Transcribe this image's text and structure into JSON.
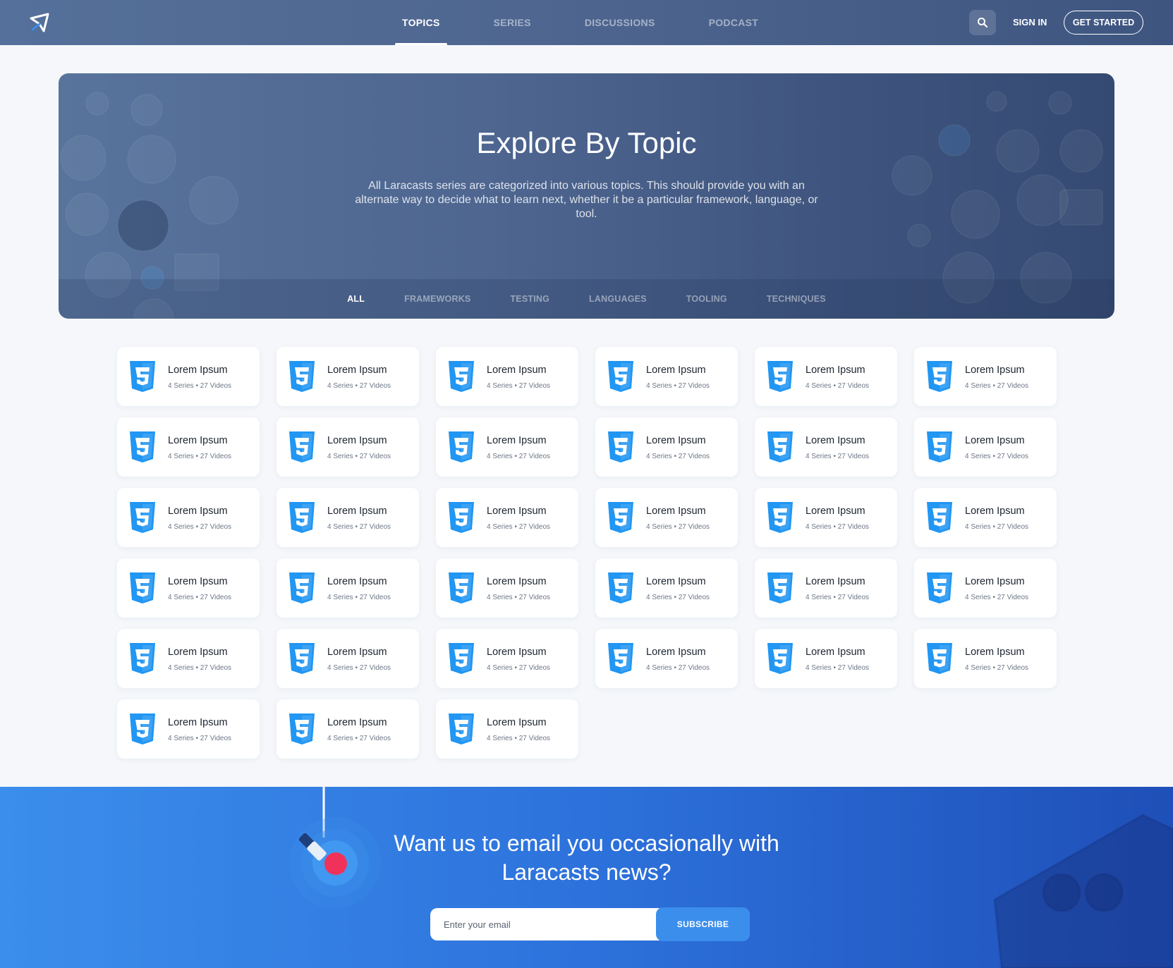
{
  "header": {
    "nav": [
      {
        "label": "TOPICS",
        "active": true
      },
      {
        "label": "SERIES",
        "active": false
      },
      {
        "label": "DISCUSSIONS",
        "active": false
      },
      {
        "label": "PODCAST",
        "active": false
      }
    ],
    "sign_in": "SIGN IN",
    "get_started": "GET STARTED",
    "logo_icon": "paper-plane-logo-icon",
    "search_icon": "search-icon"
  },
  "hero": {
    "title": "Explore By Topic",
    "description": "All Laracasts series are categorized into various topics. This should provide you with an alternate way to decide what to learn next, whether it be a particular framework, language, or tool.",
    "filters": [
      {
        "label": "ALL",
        "active": true
      },
      {
        "label": "FRAMEWORKS",
        "active": false
      },
      {
        "label": "TESTING",
        "active": false
      },
      {
        "label": "LANGUAGES",
        "active": false
      },
      {
        "label": "TOOLING",
        "active": false
      },
      {
        "label": "TECHNIQUES",
        "active": false
      }
    ]
  },
  "topics": {
    "icon": "css3-icon",
    "accent": "#2196f3",
    "items": [
      {
        "title": "Lorem Ipsum",
        "meta": "4 Series • 27 Videos"
      },
      {
        "title": "Lorem Ipsum",
        "meta": "4 Series • 27 Videos"
      },
      {
        "title": "Lorem Ipsum",
        "meta": "4 Series • 27 Videos"
      },
      {
        "title": "Lorem Ipsum",
        "meta": "4 Series • 27 Videos"
      },
      {
        "title": "Lorem Ipsum",
        "meta": "4 Series • 27 Videos"
      },
      {
        "title": "Lorem Ipsum",
        "meta": "4 Series • 27 Videos"
      },
      {
        "title": "Lorem Ipsum",
        "meta": "4 Series • 27 Videos"
      },
      {
        "title": "Lorem Ipsum",
        "meta": "4 Series • 27 Videos"
      },
      {
        "title": "Lorem Ipsum",
        "meta": "4 Series • 27 Videos"
      },
      {
        "title": "Lorem Ipsum",
        "meta": "4 Series • 27 Videos"
      },
      {
        "title": "Lorem Ipsum",
        "meta": "4 Series • 27 Videos"
      },
      {
        "title": "Lorem Ipsum",
        "meta": "4 Series • 27 Videos"
      },
      {
        "title": "Lorem Ipsum",
        "meta": "4 Series • 27 Videos"
      },
      {
        "title": "Lorem Ipsum",
        "meta": "4 Series • 27 Videos"
      },
      {
        "title": "Lorem Ipsum",
        "meta": "4 Series • 27 Videos"
      },
      {
        "title": "Lorem Ipsum",
        "meta": "4 Series • 27 Videos"
      },
      {
        "title": "Lorem Ipsum",
        "meta": "4 Series • 27 Videos"
      },
      {
        "title": "Lorem Ipsum",
        "meta": "4 Series • 27 Videos"
      },
      {
        "title": "Lorem Ipsum",
        "meta": "4 Series • 27 Videos"
      },
      {
        "title": "Lorem Ipsum",
        "meta": "4 Series • 27 Videos"
      },
      {
        "title": "Lorem Ipsum",
        "meta": "4 Series • 27 Videos"
      },
      {
        "title": "Lorem Ipsum",
        "meta": "4 Series • 27 Videos"
      },
      {
        "title": "Lorem Ipsum",
        "meta": "4 Series • 27 Videos"
      },
      {
        "title": "Lorem Ipsum",
        "meta": "4 Series • 27 Videos"
      },
      {
        "title": "Lorem Ipsum",
        "meta": "4 Series • 27 Videos"
      },
      {
        "title": "Lorem Ipsum",
        "meta": "4 Series • 27 Videos"
      },
      {
        "title": "Lorem Ipsum",
        "meta": "4 Series • 27 Videos"
      },
      {
        "title": "Lorem Ipsum",
        "meta": "4 Series • 27 Videos"
      },
      {
        "title": "Lorem Ipsum",
        "meta": "4 Series • 27 Videos"
      },
      {
        "title": "Lorem Ipsum",
        "meta": "4 Series • 27 Videos"
      },
      {
        "title": "Lorem Ipsum",
        "meta": "4 Series • 27 Videos"
      },
      {
        "title": "Lorem Ipsum",
        "meta": "4 Series • 27 Videos"
      },
      {
        "title": "Lorem Ipsum",
        "meta": "4 Series • 27 Videos"
      }
    ]
  },
  "newsletter": {
    "title_line1": "Want us to email you occasionally with",
    "title_line2": "Laracasts news?",
    "email_placeholder": "Enter your email",
    "subscribe_label": "SUBSCRIBE"
  }
}
